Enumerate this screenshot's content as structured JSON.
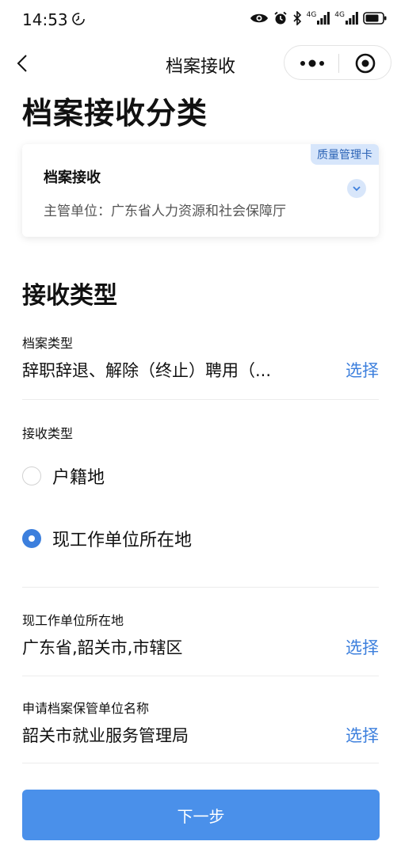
{
  "status_bar": {
    "time": "14:53",
    "icons": [
      "eye-icon",
      "alarm-icon",
      "bluetooth-icon",
      "signal-4g-icon",
      "signal-4g-icon",
      "battery-icon"
    ],
    "signal_label": "4G"
  },
  "nav": {
    "title": "档案接收"
  },
  "page": {
    "heading": "档案接收分类"
  },
  "card": {
    "tag": "质量管理卡",
    "title": "档案接收",
    "subtitle": "主管单位：广东省人力资源和社会保障厅"
  },
  "section": {
    "title": "接收类型"
  },
  "fields": {
    "archive_type": {
      "label": "档案类型",
      "value": "辞职辞退、解除（终止）聘用（...",
      "action": "选择"
    },
    "receive_type": {
      "label": "接收类型",
      "options": [
        {
          "label": "户籍地",
          "checked": false
        },
        {
          "label": "现工作单位所在地",
          "checked": true
        }
      ]
    },
    "work_location": {
      "label": "现工作单位所在地",
      "value": "广东省,韶关市,市辖区",
      "action": "选择"
    },
    "custodian": {
      "label": "申请档案保管单位名称",
      "value": "韶关市就业服务管理局",
      "action": "选择"
    }
  },
  "footer": {
    "next_label": "下一步"
  },
  "colors": {
    "accent": "#3c7fdd",
    "button": "#4a90ea",
    "tag_bg": "#d7e6fb"
  }
}
